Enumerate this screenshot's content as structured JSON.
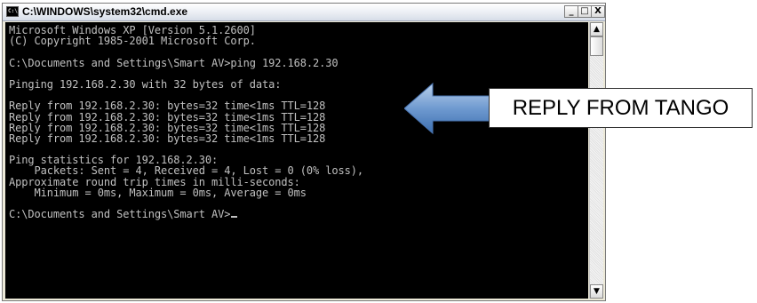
{
  "window": {
    "title": "C:\\WINDOWS\\system32\\cmd.exe",
    "icon": "cmd-icon",
    "minimize_label": "_",
    "maximize_label": "□",
    "close_label": "X"
  },
  "console": {
    "lines": [
      "Microsoft Windows XP [Version 5.1.2600]",
      "(C) Copyright 1985-2001 Microsoft Corp.",
      "",
      "C:\\Documents and Settings\\Smart AV>ping 192.168.2.30",
      "",
      "Pinging 192.168.2.30 with 32 bytes of data:",
      "",
      "Reply from 192.168.2.30: bytes=32 time<1ms TTL=128",
      "Reply from 192.168.2.30: bytes=32 time<1ms TTL=128",
      "Reply from 192.168.2.30: bytes=32 time<1ms TTL=128",
      "Reply from 192.168.2.30: bytes=32 time<1ms TTL=128",
      "",
      "Ping statistics for 192.168.2.30:",
      "    Packets: Sent = 4, Received = 4, Lost = 0 (0% loss),",
      "Approximate round trip times in milli-seconds:",
      "    Minimum = 0ms, Maximum = 0ms, Average = 0ms",
      "",
      "C:\\Documents and Settings\\Smart AV>"
    ]
  },
  "scrollbar": {
    "up_label": "▲",
    "down_label": "▼"
  },
  "annotation": {
    "text": "REPLY FROM TANGO",
    "arrow_color": "#4f81bd"
  }
}
